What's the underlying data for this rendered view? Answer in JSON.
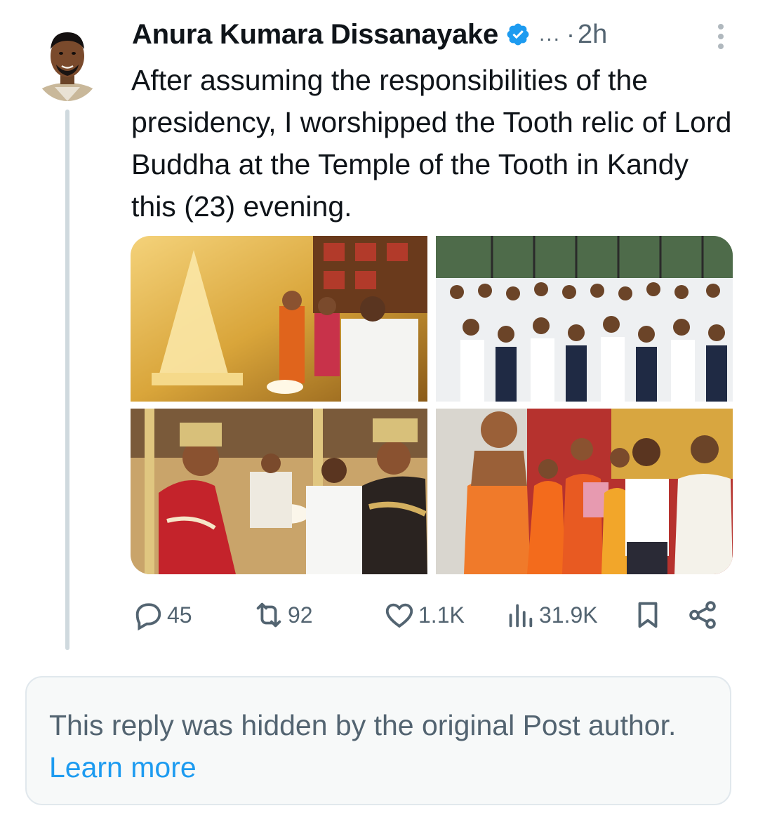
{
  "post": {
    "author_name": "Anura Kumara Dissanayake",
    "verified_icon": "verified-badge-icon",
    "handle_truncated": "...",
    "separator": "·",
    "timestamp": "2h",
    "text": "After assuming the responsibilities of the presidency, I worshipped the Tooth relic of Lord Buddha at the Temple of the Tooth in Kandy this (23) evening.",
    "photos": [
      {
        "name": "photo-golden-relic-casket"
      },
      {
        "name": "photo-crowd-gathering"
      },
      {
        "name": "photo-ceremonial-offering"
      },
      {
        "name": "photo-monks-presentation"
      }
    ]
  },
  "actions": {
    "replies": "45",
    "reposts": "92",
    "likes": "1.1K",
    "views": "31.9K"
  },
  "hidden_reply": {
    "message": "This reply was hidden by the original Post author.",
    "link": "Learn more"
  },
  "colors": {
    "text_primary": "#0f1419",
    "text_secondary": "#536471",
    "accent": "#1d9bf0",
    "thread_line": "#cfd9de",
    "notice_background": "#f7f9f9"
  }
}
